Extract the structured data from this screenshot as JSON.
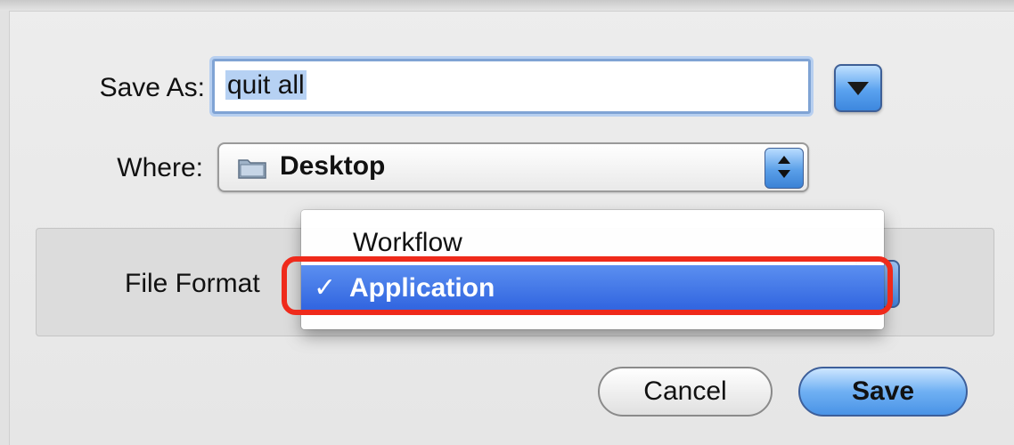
{
  "dialog": {
    "save_as_label": "Save As:",
    "save_as_value": "quit all",
    "where_label": "Where:",
    "where_value": "Desktop",
    "file_format_label": "File Format",
    "file_format_options": [
      "Workflow",
      "Application"
    ],
    "file_format_selected": "Application",
    "checkmark": "✓",
    "cancel_label": "Cancel",
    "save_label": "Save"
  },
  "colors": {
    "highlight_ring": "#ef2a1b",
    "selected_item": "#3a6de4",
    "aqua_blue": "#5aa2ef"
  },
  "icons": {
    "where": "folder-icon",
    "disclosure": "triangle-down-icon",
    "stepper": "up-down-arrows-icon"
  }
}
